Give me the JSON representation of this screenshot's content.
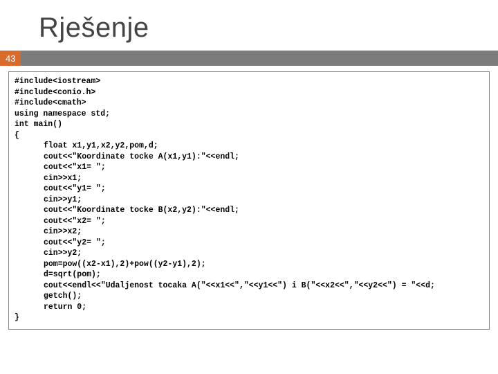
{
  "title": "Rješenje",
  "slide_number": "43",
  "code": {
    "l01": "#include<iostream>",
    "l02": "#include<conio.h>",
    "l03": "#include<cmath>",
    "l04": "using namespace std;",
    "l05": "int main()",
    "l06": "{",
    "l07": "float x1,y1,x2,y2,pom,d;",
    "l08": "cout<<\"Koordinate tocke A(x1,y1):\"<<endl;",
    "l09": "cout<<\"x1= \";",
    "l10": "cin>>x1;",
    "l11": "cout<<\"y1= \";",
    "l12": "cin>>y1;",
    "l13": "cout<<\"Koordinate tocke B(x2,y2):\"<<endl;",
    "l14": "cout<<\"x2= \";",
    "l15": "cin>>x2;",
    "l16": "cout<<\"y2= \";",
    "l17": "cin>>y2;",
    "l18": "pom=pow((x2-x1),2)+pow((y2-y1),2);",
    "l19": "d=sqrt(pom);",
    "l20": "cout<<endl<<\"Udaljenost tocaka A(\"<<x1<<\",\"<<y1<<\") i B(\"<<x2<<\",\"<<y2<<\") = \"<<d;",
    "l21": "getch();",
    "l22": "return 0;",
    "l23": "}"
  }
}
